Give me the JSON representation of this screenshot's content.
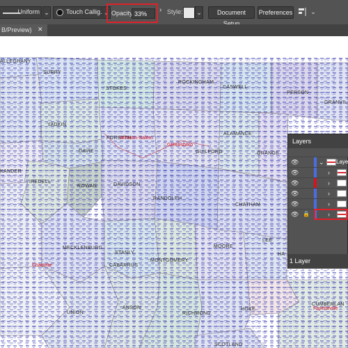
{
  "control_bar": {
    "stroke_profile": "Uniform",
    "brush_name": "Touch Callig...",
    "opacity_label": "Opacity:",
    "opacity_value": "33%",
    "style_label": "Style:",
    "document_setup_label": "Document Setup",
    "preferences_label": "Preferences"
  },
  "tab": {
    "title": "B/Preview)",
    "close_icon": "close-icon"
  },
  "map": {
    "counties": [
      "ALLEGHANY",
      "SURRY",
      "STOKES",
      "ROCKINGHAM",
      "CASWELL",
      "PERSON",
      "GRANVIL",
      "YADKIN",
      "FORSYTH",
      "DAVIE",
      "GUILFORD",
      "ALAMANCE",
      "ORANGE",
      "KANDER",
      "IREDELL",
      "DAVIDSON",
      "ROWAN",
      "RANDOLPH",
      "CHATHAM",
      "MECKLENBURG",
      "STANLY",
      "CABARRUS",
      "MONTGOMERY",
      "MOORE",
      "LEE",
      "HA",
      "UNION",
      "ANSON",
      "RICHMOND",
      "HOKE",
      "CUMBERLAN",
      "SCOTLAND"
    ],
    "cities": [
      "Winston-Salem",
      "Greensboro",
      "Charlotte",
      "Fayetteville"
    ]
  },
  "layers_panel": {
    "title": "Layers",
    "rows": [
      {
        "name": "Laye",
        "visible": "eye-icon",
        "locked": false,
        "color": "#4a6ee0"
      },
      {
        "name": "",
        "visible": "eye-icon",
        "locked": false,
        "color": "#4a6ee0"
      },
      {
        "name": "",
        "visible": "eye-icon",
        "locked": false,
        "color": "#d6141f"
      },
      {
        "name": "",
        "visible": "eye-icon",
        "locked": false,
        "color": "#4a6ee0"
      },
      {
        "name": "",
        "visible": "eye-icon",
        "locked": false,
        "color": "#4a6ee0"
      },
      {
        "name": "",
        "visible": "eye-icon",
        "locked": true,
        "color": "#4a6ee0"
      }
    ],
    "footer": "1 Layer"
  }
}
